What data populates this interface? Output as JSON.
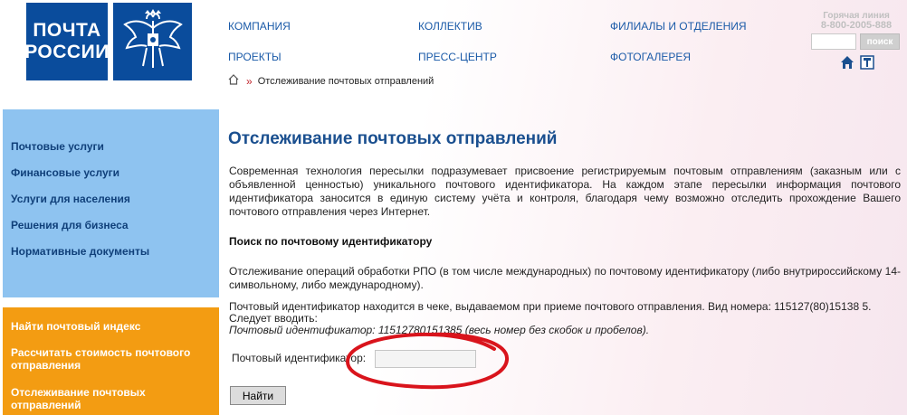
{
  "logo": {
    "line1": "ПОЧТА",
    "line2": "РОССИИ",
    "emblem_icon": "double-headed-eagle-icon"
  },
  "nav": {
    "company": "КОМПАНИЯ",
    "team": "КОЛЛЕКТИВ",
    "branches": "ФИЛИАЛЫ И ОТДЕЛЕНИЯ",
    "projects": "ПРОЕКТЫ",
    "press": "ПРЕСС-ЦЕНТР",
    "gallery": "ФОТОГАЛЕРЕЯ"
  },
  "hotline": {
    "title": "Горячая линия",
    "phone": "8-800-2005-888"
  },
  "search": {
    "button_label": "поиск",
    "value": ""
  },
  "breadcrumb": {
    "home_icon": "home-icon",
    "current": "Отслеживание почтовых отправлений"
  },
  "sidebar": {
    "blue_items": [
      "Почтовые услуги",
      "Финансовые услуги",
      "Услуги для населения",
      "Решения для бизнеса",
      "Нормативные документы"
    ],
    "orange_items": [
      "Найти почтовый индекс",
      "Рассчитать стоимость почтового отправления",
      "Отслеживание почтовых отправлений"
    ]
  },
  "main": {
    "title": "Отслеживание почтовых отправлений",
    "intro": "Современная технология пересылки подразумевает присвоение регистрируемым почтовым отправлениям (заказным или с объявленной ценностью) уникального почтового идентификатора. На каждом этапе пересылки информация почтового идентификатора заносится в единую систему учёта и контроля, благодаря чему возможно отследить прохождение Вашего почтового отправления через Интернет.",
    "subheading": "Поиск по почтовому идентификатору",
    "tracking_desc": "Отслеживание операций обработки РПО (в том числе международных) по почтовому идентификатору (либо внутрироссийскому 14-символьному, либо международному).",
    "note_line1": "Почтовый идентификатор находится в чеке, выдаваемом при приеме почтового отправления. Вид номера: 115127(80)15138 5.",
    "note_line2": "Следует вводить:",
    "note_line3": "Почтовый идентификатор: 11512780151385 (весь номер без скобок и пробелов).",
    "field_label": "Почтовый идентификатор:",
    "field_value": "",
    "find_button": "Найти"
  },
  "colors": {
    "brand_blue": "#0a4c9c",
    "sidebar_blue": "#8ec3f0",
    "sidebar_orange": "#f39c12",
    "annotation_red": "#d9141c"
  }
}
